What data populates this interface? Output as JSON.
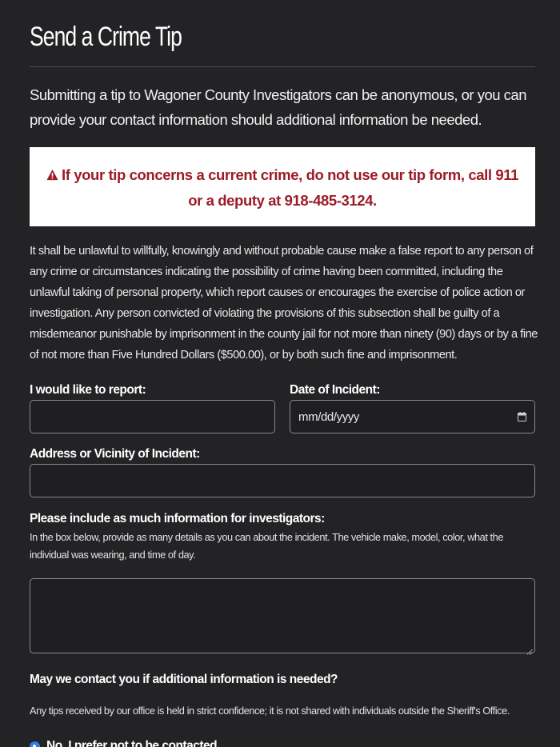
{
  "page": {
    "title": "Send a Crime Tip",
    "intro": "Submitting a tip to Wagoner County Investigators can be anonymous, or you can provide your contact information should additional information be needed."
  },
  "alert": {
    "icon": "warning-triangle-icon",
    "text": "If your tip concerns a current crime, do not use our tip form, call 911 or a deputy at 918-485-3124.",
    "color": "#9b1c26"
  },
  "legal_notice": "It shall be unlawful to willfully, knowingly and without probable cause make a false report to any person of any crime or circumstances indicating the possibility of crime having been committed, including the unlawful taking of personal property, which report causes or encourages the exercise of police action or investigation. Any person convicted of violating the provisions of this subsection shall be guilty of a misdemeanor punishable by imprisonment in the county jail for not more than ninety (90) days or by a fine of not more than Five Hundred Dollars ($500.00), or by both such fine and imprisonment.",
  "form": {
    "report_label": "I would like to report:",
    "report_value": "",
    "date_label": "Date of Incident:",
    "date_placeholder": "mm/dd/yyyy",
    "date_icon": "calendar-icon",
    "address_label": "Address or Vicinity of Incident:",
    "address_value": "",
    "details_label": "Please include as much information for investigators:",
    "details_help": "In the box below, provide as many details as you can about the incident. The vehicle make, model, color, what the individual was wearing, and time of day.",
    "details_value": "",
    "contact_question": "May we contact you if additional information is needed?",
    "confidential_note": "Any tips received by our office is held in strict confidence; it is not shared with individuals outside the Sheriff's Office.",
    "contact_option_selected": "No, I prefer not to be contacted"
  },
  "colors": {
    "background": "#232326",
    "accent": "#2f7fe8",
    "alert_text": "#9b1c26"
  }
}
